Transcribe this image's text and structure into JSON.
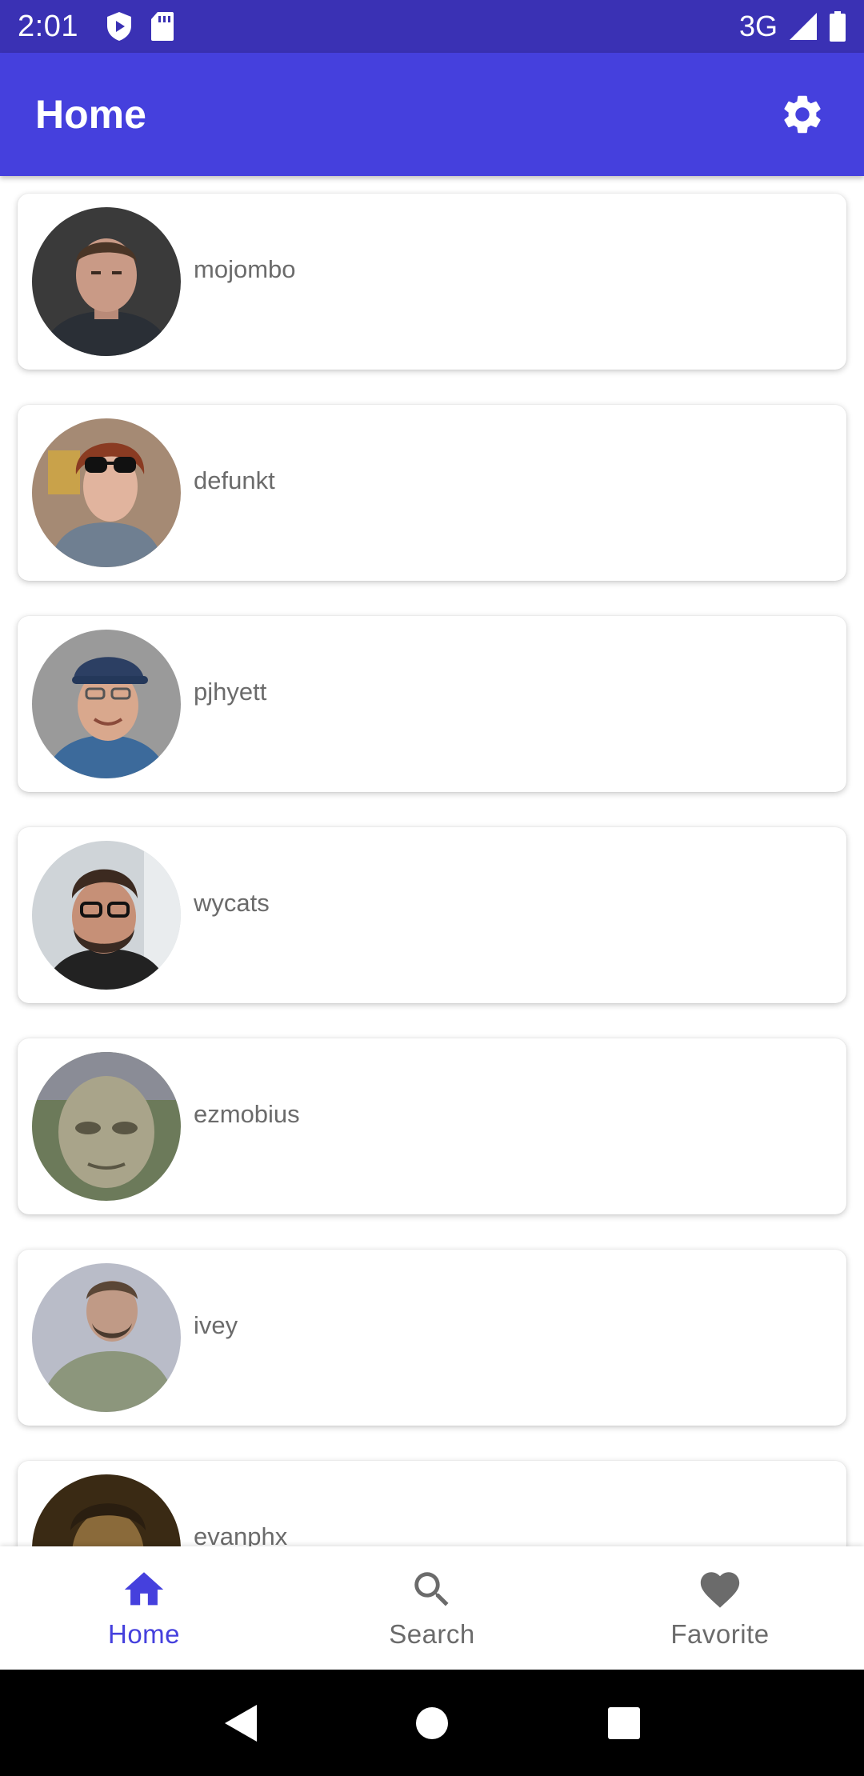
{
  "status_bar": {
    "time": "2:01",
    "network": "3G",
    "icons": [
      "shield-icon",
      "sd-card-icon",
      "signal-icon",
      "battery-icon"
    ]
  },
  "app_bar": {
    "title": "Home",
    "action_icon": "gear-icon"
  },
  "users": [
    {
      "login": "mojombo"
    },
    {
      "login": "defunkt"
    },
    {
      "login": "pjhyett"
    },
    {
      "login": "wycats"
    },
    {
      "login": "ezmobius"
    },
    {
      "login": "ivey"
    },
    {
      "login": "evanphx"
    }
  ],
  "bottom_nav": {
    "items": [
      {
        "label": "Home",
        "icon": "home-icon",
        "active": true
      },
      {
        "label": "Search",
        "icon": "search-icon",
        "active": false
      },
      {
        "label": "Favorite",
        "icon": "heart-icon",
        "active": false
      }
    ]
  },
  "theme": {
    "status_bar_color": "#3a31b4",
    "app_bar_color": "#4540dd",
    "active_color": "#4540dd",
    "inactive_color": "#6b6b6b"
  }
}
